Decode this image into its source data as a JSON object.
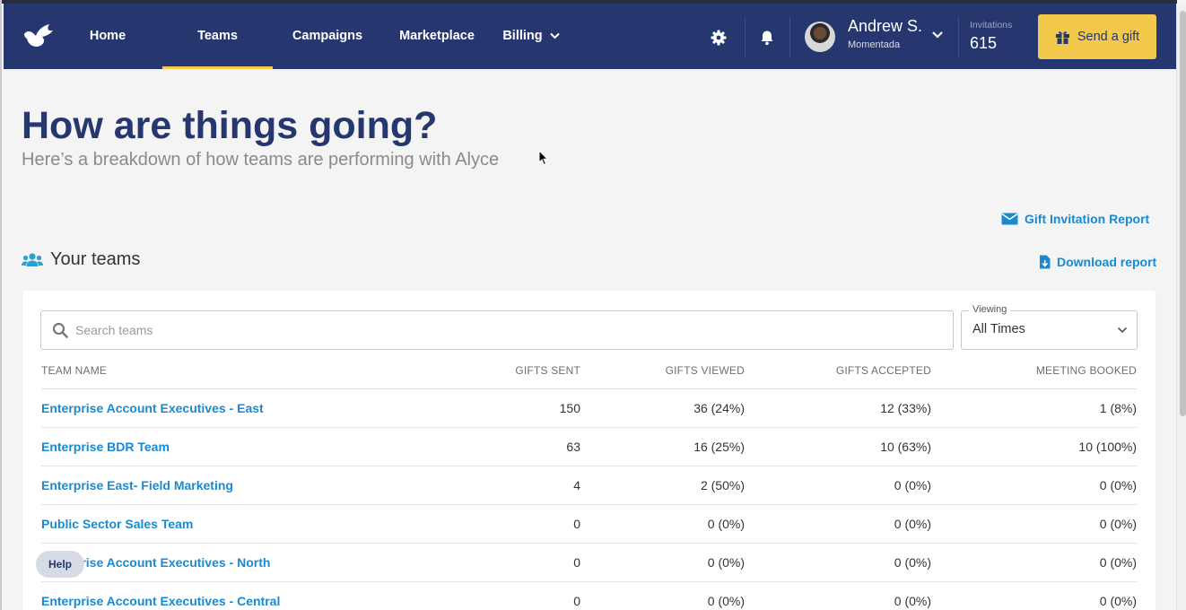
{
  "nav": {
    "items": [
      {
        "label": "Home"
      },
      {
        "label": "Teams"
      },
      {
        "label": "Campaigns"
      },
      {
        "label": "Marketplace"
      },
      {
        "label": "Billing"
      }
    ],
    "active": "Teams",
    "user": {
      "name": "Andrew S.",
      "org": "Momentada"
    },
    "invitations": {
      "label": "Invitations",
      "count": "615"
    },
    "send_gift_label": "Send a gift"
  },
  "page": {
    "title": "How are things going?",
    "subtitle": "Here’s a breakdown of how teams are performing with Alyce"
  },
  "links": {
    "gift_invitation_report": "Gift Invitation Report",
    "download_report": "Download report"
  },
  "section": {
    "title": "Your teams"
  },
  "search": {
    "placeholder": "Search teams"
  },
  "viewing": {
    "label": "Viewing",
    "value": "All Times"
  },
  "table": {
    "headers": [
      "TEAM NAME",
      "GIFTS SENT",
      "GIFTS VIEWED",
      "GIFTS ACCEPTED",
      "MEETING BOOKED"
    ],
    "rows": [
      [
        "Enterprise Account Executives - East",
        "150",
        "36 (24%)",
        "12 (33%)",
        "1 (8%)"
      ],
      [
        "Enterprise BDR Team",
        "63",
        "16 (25%)",
        "10 (63%)",
        "10 (100%)"
      ],
      [
        "Enterprise East- Field Marketing",
        "4",
        "2 (50%)",
        "0 (0%)",
        "0 (0%)"
      ],
      [
        "Public Sector Sales Team",
        "0",
        "0 (0%)",
        "0 (0%)",
        "0 (0%)"
      ],
      [
        "Enterprise Account Executives - North",
        "0",
        "0 (0%)",
        "0 (0%)",
        "0 (0%)"
      ],
      [
        "Enterprise Account Executives - Central",
        "0",
        "0 (0%)",
        "0 (0%)",
        "0 (0%)"
      ]
    ]
  },
  "help_label": "Help",
  "colors": {
    "nav_bg": "#263770",
    "accent_yellow": "#f2c94c",
    "link_blue": "#1a8ad0",
    "title_navy": "#263770"
  },
  "icons": [
    "dove-logo-icon",
    "gear-icon",
    "bell-icon",
    "chevron-down-icon",
    "gift-icon",
    "envelope-icon",
    "file-download-icon",
    "users-icon",
    "search-icon"
  ]
}
